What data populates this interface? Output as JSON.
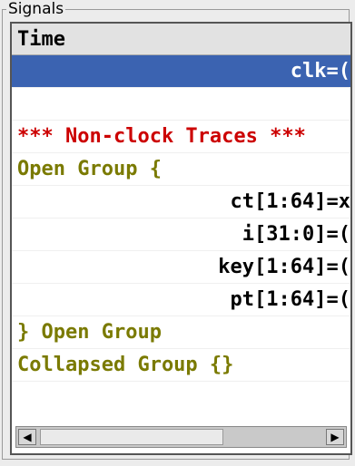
{
  "panel": {
    "title": "Signals"
  },
  "signals_table": {
    "header": "Time",
    "rows": [
      {
        "text": "clk=(",
        "style": "selected-right"
      },
      {
        "text": "",
        "style": "blank"
      },
      {
        "text": "*** Non-clock Traces ***",
        "style": "red-left"
      },
      {
        "text": "Open Group {",
        "style": "olive-left"
      },
      {
        "text": "ct[1:64]=x",
        "style": "black-right"
      },
      {
        "text": "i[31:0]=(",
        "style": "black-right"
      },
      {
        "text": "key[1:64]=(",
        "style": "black-right"
      },
      {
        "text": "pt[1:64]=(",
        "style": "black-right"
      },
      {
        "text": "} Open Group",
        "style": "olive-left"
      },
      {
        "text": "Collapsed Group {}",
        "style": "olive-left"
      }
    ]
  },
  "scrollbar": {
    "left_arrow": "◀",
    "right_arrow": "▶"
  },
  "colors": {
    "selection": "#3b63b1",
    "comment_red": "#cc0000",
    "group_olive": "#7a7a00"
  }
}
